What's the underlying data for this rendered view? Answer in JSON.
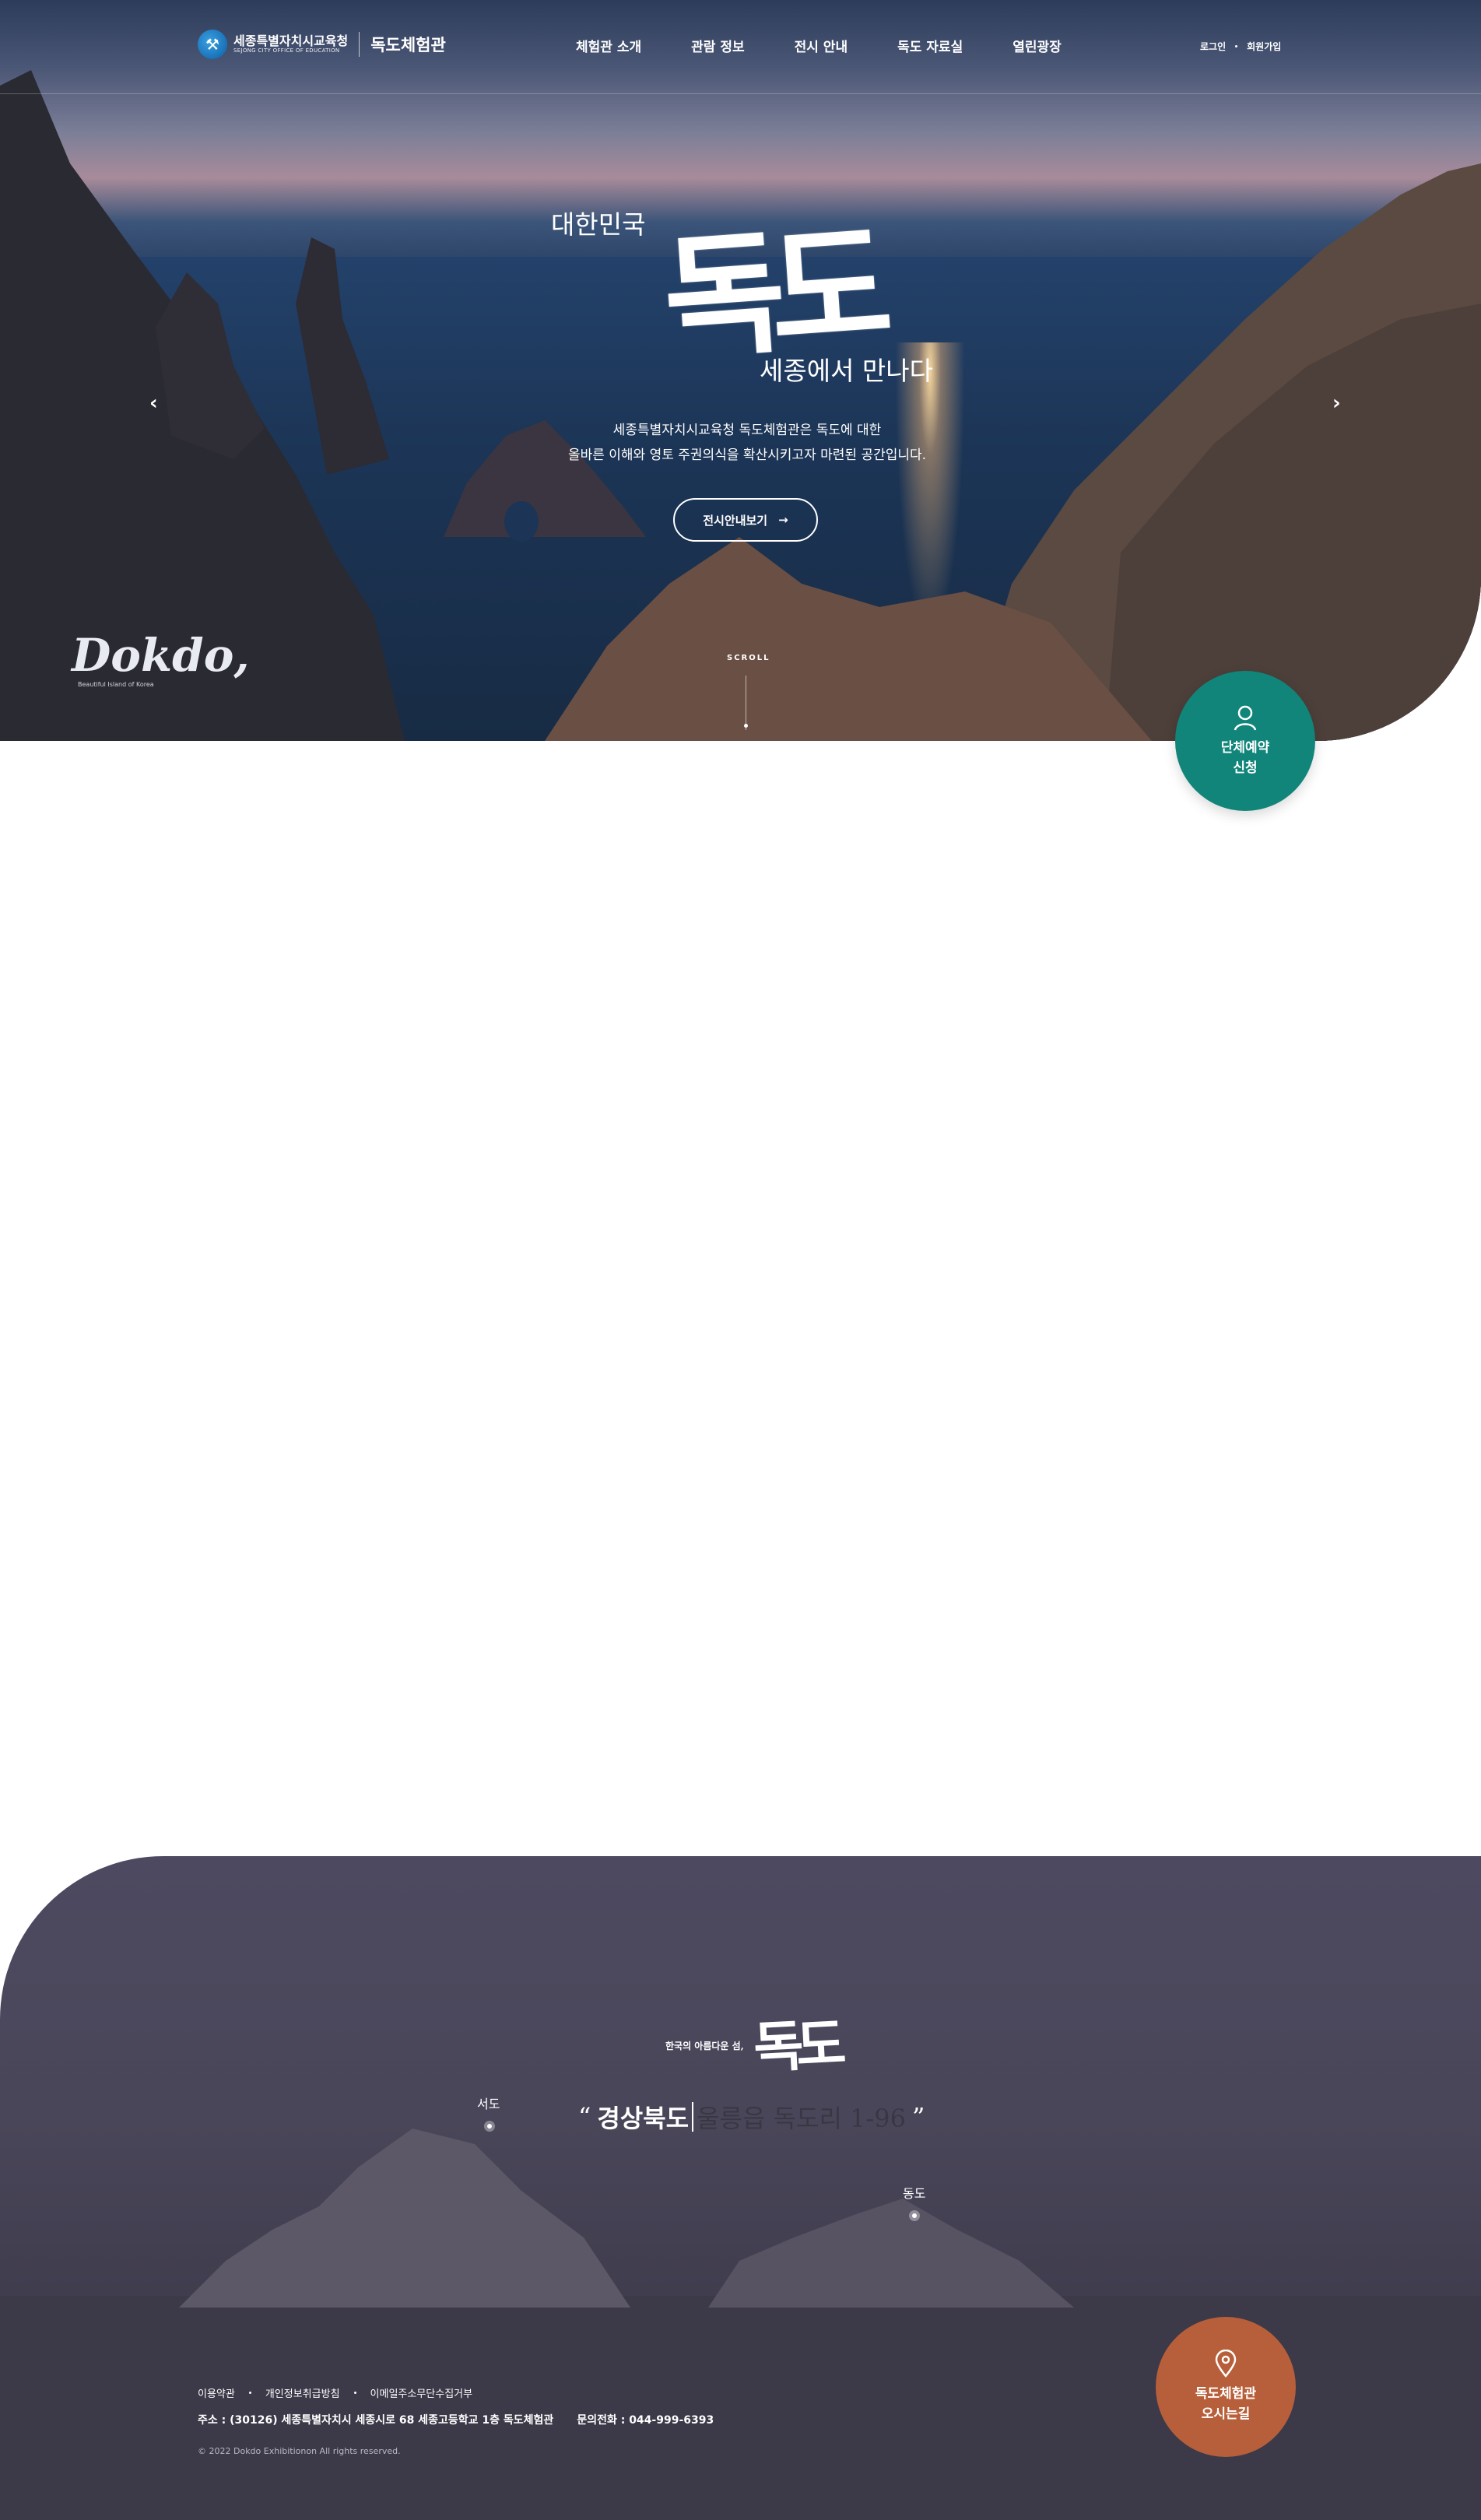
{
  "header": {
    "org_name": "세종특별자치시교육청",
    "org_sub": "SEJONG CITY OFFICE OF EDUCATION",
    "site_name": "독도체험관",
    "nav": [
      "체험관 소개",
      "관람 정보",
      "전시 안내",
      "독도 자료실",
      "열린광장"
    ],
    "login": "로그인",
    "signup": "회원가입"
  },
  "hero": {
    "title_prefix": "대한민국",
    "title_main": "독도",
    "title_suffix": "세종에서 만나다",
    "desc_line1": "세종특별자치시교육청 독도체험관은 독도에 대한",
    "desc_line2": "올바른 이해와 영토 주권의식을 확산시키고자 마련된 공간입니다.",
    "cta": "전시안내보기",
    "scroll": "SCROLL",
    "brand": "Dokdo,",
    "brand_sub": "Beautiful Island of Korea",
    "prev": "‹",
    "next": "›"
  },
  "booking": {
    "line1": "단체예약",
    "line2": "신청"
  },
  "location": {
    "small": "한국의 아름다운 섬,",
    "title": "독도",
    "addr_main": "경상북도",
    "addr_rest": "울릉읍 독도리 1-96",
    "quote_open": "“",
    "quote_close": "”",
    "west": "서도",
    "east": "동도"
  },
  "footer": {
    "links": [
      "이용약관",
      "개인정보취급방침",
      "이메일주소무단수집거부"
    ],
    "address": "주소 : (30126) 세종특별자치시 세종시로 68 세종고등학교 1층 독도체험관",
    "phone": "문의전화 : 044-999-6393",
    "copyright": "© 2022 Dokdo Exhibitionon All rights reserved."
  },
  "directions": {
    "line1": "독도체험관",
    "line2": "오시는길"
  },
  "colors": {
    "booking": "#118579",
    "directions": "#b75f3a",
    "footer_bg": "#4a4659"
  }
}
